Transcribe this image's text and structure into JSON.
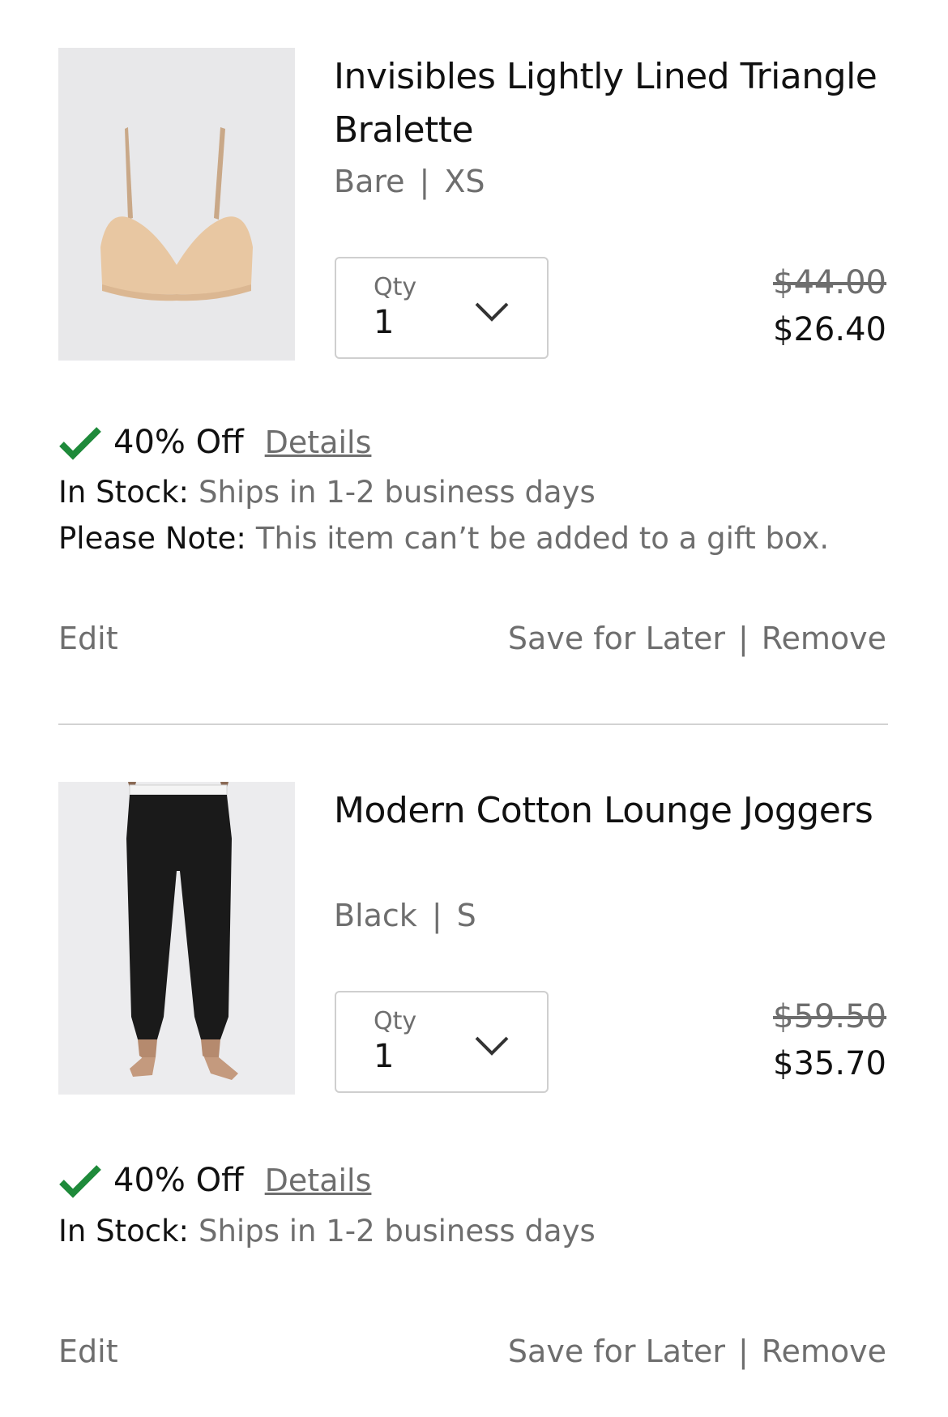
{
  "items": [
    {
      "title": "Invisibles Lightly Lined Triangle Bralette",
      "color": "Bare",
      "size": "XS",
      "qty_label": "Qty",
      "qty_value": "1",
      "price_original": "$44.00",
      "price_sale": "$26.40",
      "promo_text": "40% Off",
      "promo_link": "Details",
      "stock_label": "In Stock:",
      "stock_value": "Ships in 1-2 business days",
      "note_label": "Please Note:",
      "note_value": "This item can’t be added to a gift box.",
      "edit_label": "Edit",
      "save_label": "Save for Later",
      "remove_label": "Remove"
    },
    {
      "title": "Modern Cotton Lounge Joggers",
      "color": "Black",
      "size": "S",
      "qty_label": "Qty",
      "qty_value": "1",
      "price_original": "$59.50",
      "price_sale": "$35.70",
      "promo_text": "40% Off",
      "promo_link": "Details",
      "stock_label": "In Stock:",
      "stock_value": "Ships in 1-2 business days",
      "edit_label": "Edit",
      "save_label": "Save for Later",
      "remove_label": "Remove"
    }
  ],
  "variant_separator": "|",
  "action_separator": "|",
  "colors": {
    "text": "#111111",
    "muted": "#6e6e6e",
    "check": "#1e8a3a",
    "divider": "#d2d2d2"
  },
  "icons": [
    "check-icon",
    "chevron-down-icon"
  ]
}
